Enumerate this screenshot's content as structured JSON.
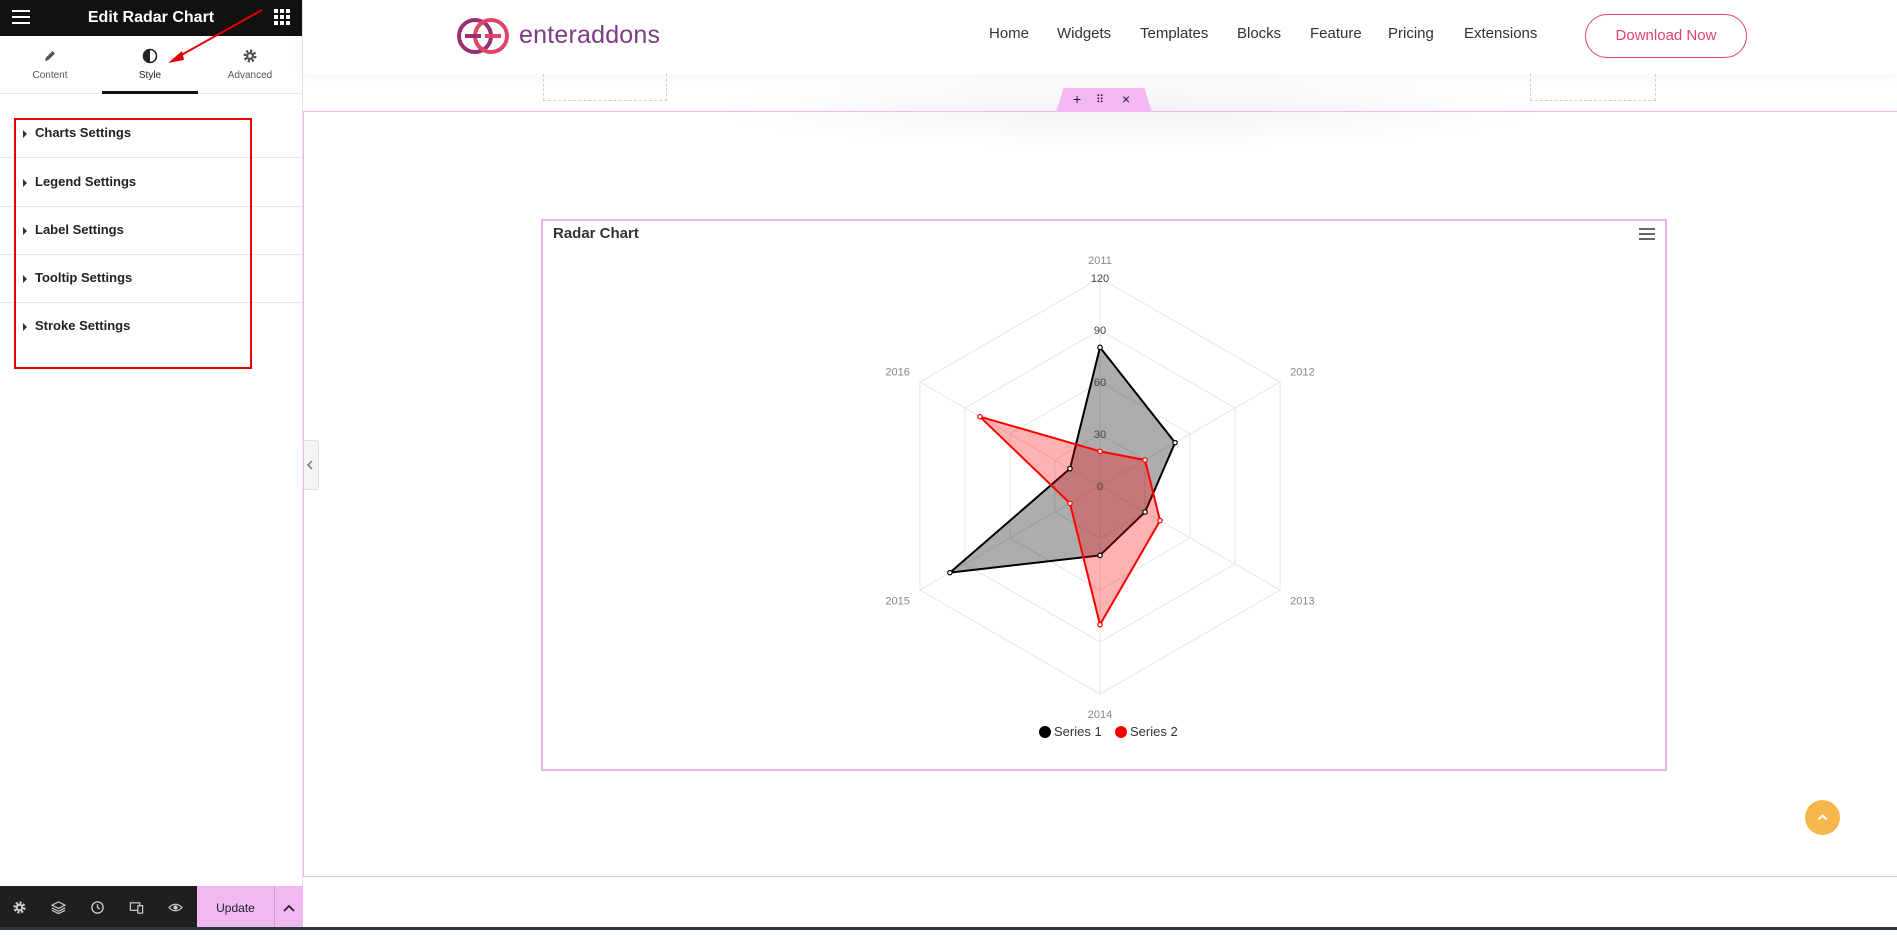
{
  "panel": {
    "title": "Edit Radar Chart",
    "tabs": [
      {
        "label": "Content",
        "icon": "pencil-icon"
      },
      {
        "label": "Style",
        "icon": "half-circle-icon"
      },
      {
        "label": "Advanced",
        "icon": "gear-icon"
      }
    ],
    "active_tab": "Style",
    "sections": [
      {
        "label": "Charts Settings"
      },
      {
        "label": "Legend Settings"
      },
      {
        "label": "Label Settings"
      },
      {
        "label": "Tooltip Settings"
      },
      {
        "label": "Stroke Settings"
      }
    ],
    "footer": {
      "icons": [
        "settings-icon",
        "layers-icon",
        "history-icon",
        "responsive-icon",
        "preview-eye-icon"
      ],
      "update_label": "Update"
    },
    "highlight_color": "#e60000"
  },
  "site": {
    "logo_text": "enteraddons",
    "brand_color": "#7d3a86",
    "accent_color": "#e0446a",
    "nav": [
      "Home",
      "Widgets",
      "Templates",
      "Blocks",
      "Feature",
      "Pricing",
      "Extensions"
    ],
    "cta": "Download Now"
  },
  "widget": {
    "title": "Radar Chart"
  },
  "chart_data": {
    "type": "radar",
    "categories": [
      "2011",
      "2012",
      "2013",
      "2014",
      "2015",
      "2016"
    ],
    "r_ticks": [
      "0",
      "30",
      "60",
      "90",
      "120"
    ],
    "rlim": [
      0,
      120
    ],
    "series": [
      {
        "name": "Series 1",
        "color": "#000000",
        "values": [
          80,
          50,
          30,
          40,
          100,
          20
        ]
      },
      {
        "name": "Series 2",
        "color": "#ff0000",
        "values": [
          20,
          30,
          40,
          80,
          20,
          80
        ]
      }
    ],
    "legend_position": "bottom",
    "grid": true
  }
}
